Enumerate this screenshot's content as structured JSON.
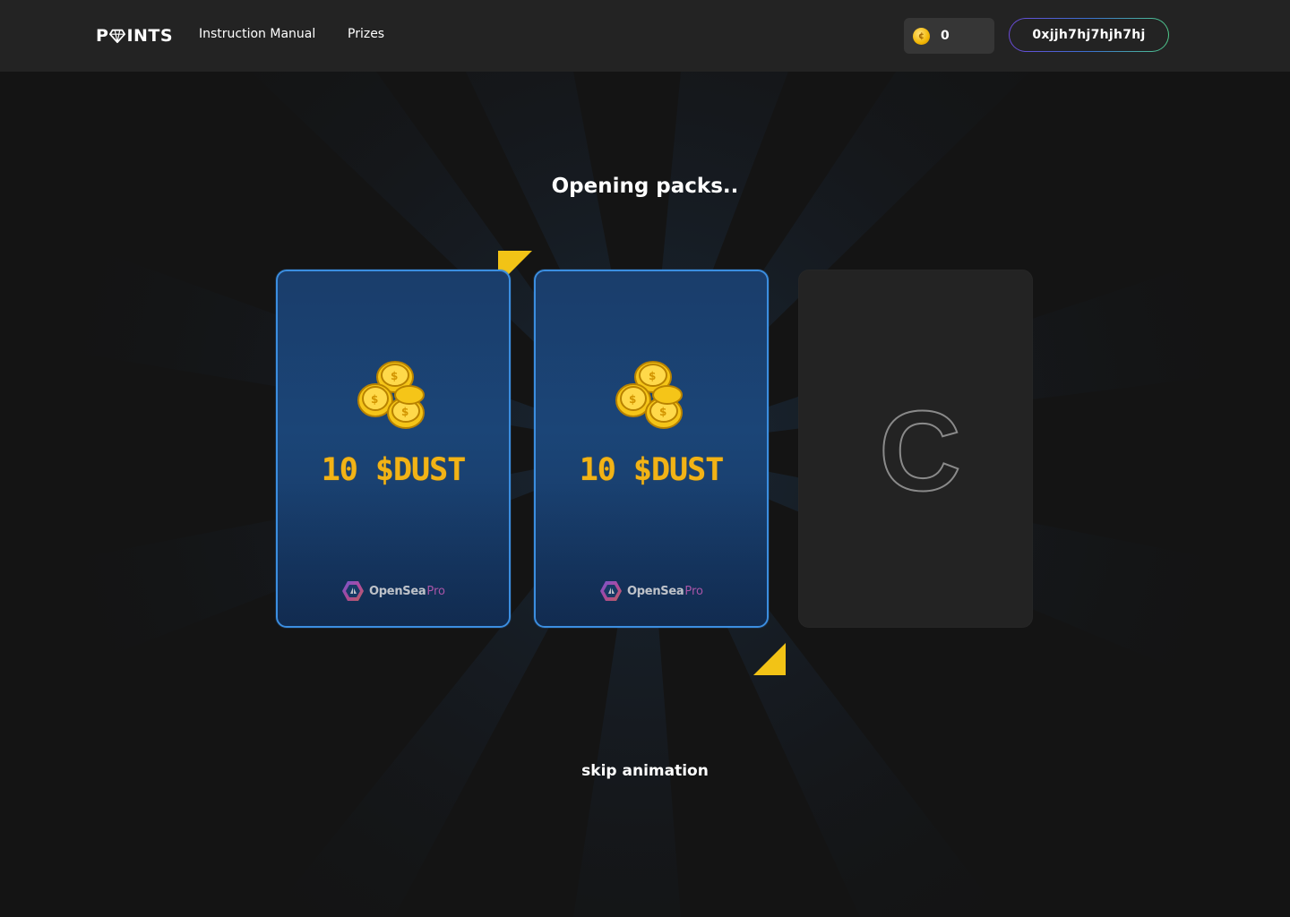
{
  "header": {
    "logo": "POINTS",
    "nav": {
      "manual": "Instruction Manual",
      "prizes": "Prizes"
    },
    "balance": "0",
    "wallet": "0xjjh7hj7hjh7hj"
  },
  "main": {
    "title": "Opening packs..",
    "cards": [
      {
        "state": "revealed",
        "prize": "10 $DUST",
        "brand": "OpenSea",
        "brand_suffix": "Pro"
      },
      {
        "state": "revealed",
        "prize": "10 $DUST",
        "brand": "OpenSea",
        "brand_suffix": "Pro"
      },
      {
        "state": "hidden",
        "letter": "C"
      }
    ],
    "skip": "skip animation"
  },
  "colors": {
    "accent_yellow": "#f2b316",
    "card_border": "#3b8ee0",
    "card_bg": "#1b4577",
    "header_bg": "#232323",
    "page_bg": "#141414"
  },
  "icons": [
    "gem-icon",
    "coin-icon",
    "coin-stack-icon",
    "opensea-pro-logo-icon"
  ]
}
